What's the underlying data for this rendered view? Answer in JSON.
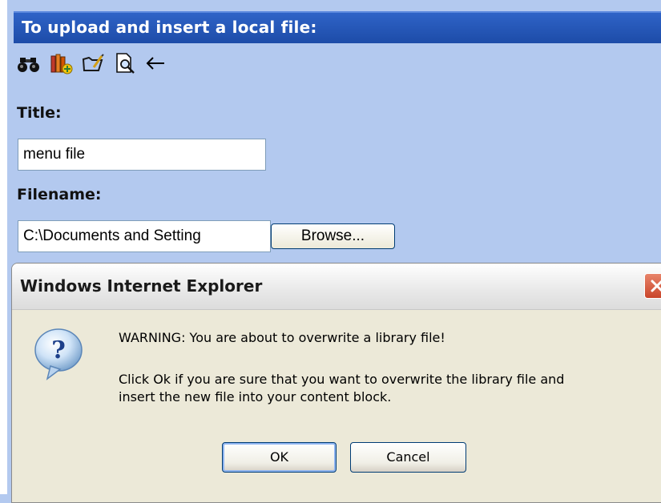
{
  "header": {
    "title": "To upload and insert a local file:"
  },
  "toolbar": {
    "icons": [
      "binoculars-icon",
      "library-books-icon",
      "edit-folder-icon",
      "preview-document-icon",
      "back-arrow-icon"
    ]
  },
  "form": {
    "title_label": "Title:",
    "title_value": "menu file",
    "filename_label": "Filename:",
    "filename_value": "C:\\Documents and Setting",
    "browse_label": "Browse..."
  },
  "dialog": {
    "title": "Windows Internet Explorer",
    "warning": "WARNING: You are about to overwrite a library file!",
    "message_line1": "Click Ok if you are sure that you want to overwrite the library file and",
    "message_line2": "insert the new file into your content block.",
    "ok_label": "OK",
    "cancel_label": "Cancel"
  },
  "colors": {
    "panel_bg": "#b3c9ef",
    "header_bg": "#2150b0",
    "dialog_bg": "#ece9d8",
    "close_red": "#d5532f"
  }
}
